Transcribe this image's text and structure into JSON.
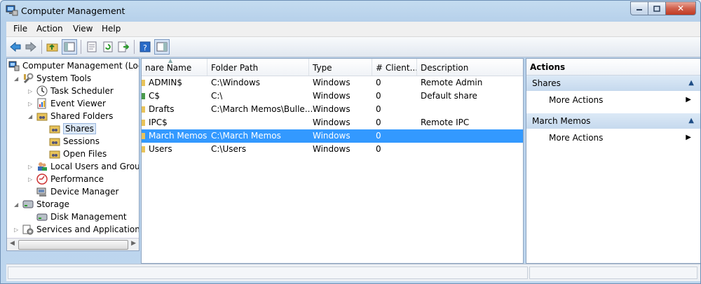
{
  "window": {
    "title": "Computer Management",
    "controls": {
      "minimize_icon": "minimize-icon",
      "maximize_icon": "maximize-icon",
      "close": "✕"
    }
  },
  "menu": [
    "File",
    "Action",
    "View",
    "Help"
  ],
  "toolbar": {
    "icons": [
      "back-icon",
      "forward-icon",
      "up-folder-icon",
      "show-hide-tree-icon",
      "properties-icon",
      "refresh-icon",
      "export-list-icon",
      "help-icon",
      "show-hide-action-pane-icon"
    ]
  },
  "tree": {
    "root": "Computer Management (Local",
    "system_tools": "System Tools",
    "task_scheduler": "Task Scheduler",
    "event_viewer": "Event Viewer",
    "shared_folders": "Shared Folders",
    "shares": "Shares",
    "sessions": "Sessions",
    "open_files": "Open Files",
    "local_users": "Local Users and Groups",
    "performance": "Performance",
    "device_manager": "Device Manager",
    "storage": "Storage",
    "disk_management": "Disk Management",
    "services": "Services and Applications"
  },
  "list": {
    "columns": [
      "nare Name",
      "Folder Path",
      "Type",
      "# Client...",
      "Description"
    ],
    "rows": [
      {
        "name": "ADMIN$",
        "path": "C:\\Windows",
        "type": "Windows",
        "clients": "0",
        "description": "Remote Admin"
      },
      {
        "name": "C$",
        "path": "C:\\",
        "type": "Windows",
        "clients": "0",
        "description": "Default share"
      },
      {
        "name": "Drafts",
        "path": "C:\\March Memos\\Bulle...",
        "type": "Windows",
        "clients": "0",
        "description": ""
      },
      {
        "name": "IPC$",
        "path": "",
        "type": "Windows",
        "clients": "0",
        "description": "Remote IPC"
      },
      {
        "name": "March Memos",
        "path": "C:\\March Memos",
        "type": "Windows",
        "clients": "0",
        "description": ""
      },
      {
        "name": "Users",
        "path": "C:\\Users",
        "type": "Windows",
        "clients": "0",
        "description": ""
      }
    ],
    "selected_row": "March Memos"
  },
  "actions": {
    "title": "Actions",
    "sections": [
      {
        "label": "Shares",
        "item": "More Actions"
      },
      {
        "label": "March Memos",
        "item": "More Actions"
      }
    ]
  },
  "colors": {
    "selection": "#3399ff",
    "section_bg": "#c6d9ee"
  }
}
